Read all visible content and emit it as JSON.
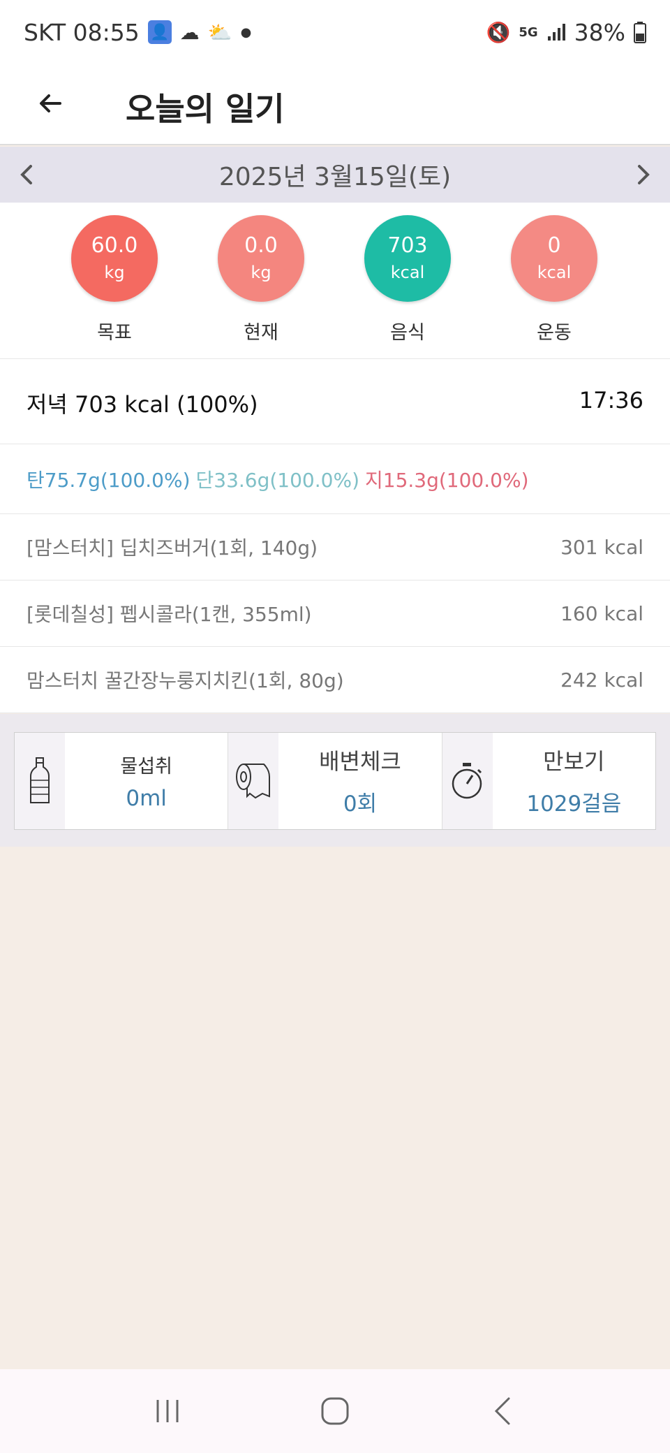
{
  "status_bar": {
    "carrier_time": "SKT 08:55",
    "battery": "38%",
    "network": "5G"
  },
  "header": {
    "title": "오늘의 일기"
  },
  "date_bar": {
    "date": "2025년 3월15일(토)"
  },
  "summary": {
    "items": [
      {
        "value": "60.0",
        "unit": "kg",
        "label": "목표",
        "color": "#f46a61"
      },
      {
        "value": "0.0",
        "unit": "kg",
        "label": "현재",
        "color": "#f4867f"
      },
      {
        "value": "703",
        "unit": "kcal",
        "label": "음식",
        "color": "#1ebca5"
      },
      {
        "value": "0",
        "unit": "kcal",
        "label": "운동",
        "color": "#f48a84"
      }
    ]
  },
  "meal": {
    "summary": "저녁 703 kcal (100%)",
    "time": "17:36",
    "nutrition": {
      "carb": "탄75.7g(100.0%)",
      "protein": "단33.6g(100.0%)",
      "fat": "지15.3g(100.0%)"
    },
    "foods": [
      {
        "name": "[맘스터치] 딥치즈버거(1회, 140g)",
        "kcal": "301 kcal"
      },
      {
        "name": "[롯데칠성] 펩시콜라(1캔, 355ml)",
        "kcal": "160 kcal"
      },
      {
        "name": "맘스터치 꿀간장누룽지치킨(1회, 80g)",
        "kcal": "242 kcal"
      }
    ]
  },
  "cards": {
    "water": {
      "label": "물섭취",
      "value": "0ml",
      "icon": "water-bottle-icon"
    },
    "bowel": {
      "label": "배변체크",
      "value": "0회",
      "icon": "toilet-paper-icon"
    },
    "steps": {
      "label": "만보기",
      "value": "1029걸음",
      "icon": "stopwatch-icon"
    }
  }
}
